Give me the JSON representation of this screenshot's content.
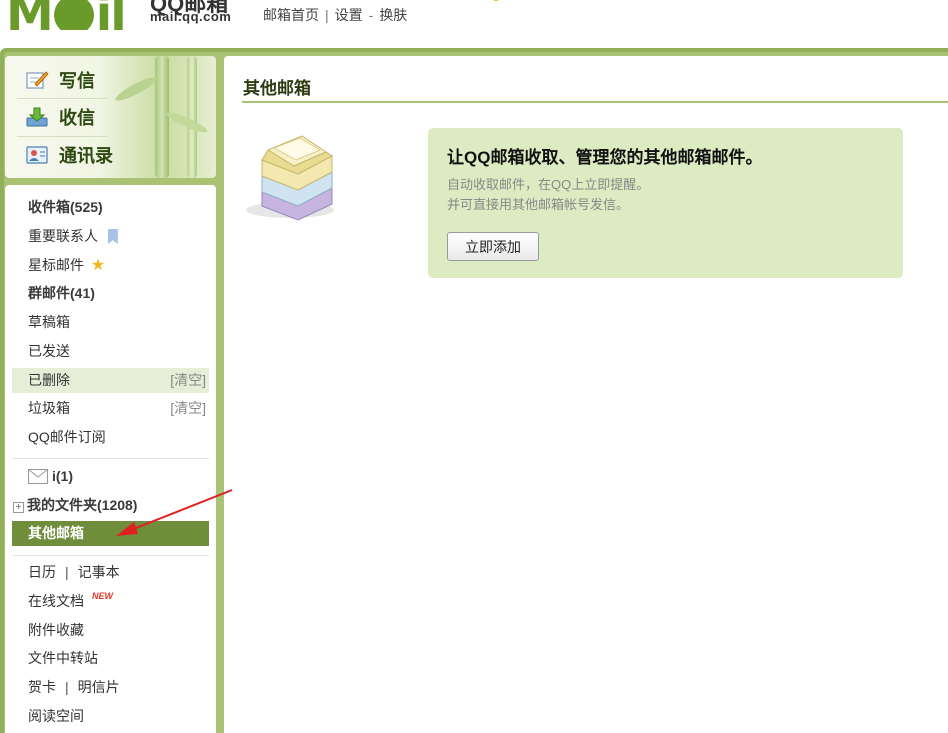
{
  "header": {
    "logo_letters": "M  il",
    "brand_cn": "QQ邮箱",
    "brand_url": "mail.qq.com",
    "links": [
      "邮箱首页",
      "设置",
      "换肤"
    ],
    "separators": [
      "|",
      "-"
    ]
  },
  "compose": {
    "items": [
      {
        "label": "写信",
        "icon": "pencil-paper-icon"
      },
      {
        "label": "收信",
        "icon": "download-tray-icon"
      },
      {
        "label": "通讯录",
        "icon": "contact-card-icon"
      }
    ]
  },
  "folders": {
    "inbox": "收件箱(525)",
    "important_contacts": "重要联系人",
    "starred": "星标邮件",
    "group_mail": "群邮件(41)",
    "drafts": "草稿箱",
    "sent": "已发送",
    "deleted": "已删除",
    "spam": "垃圾箱",
    "clear_label": "[清空]",
    "subscriptions": "QQ邮件订阅",
    "mail_i": "i(1)",
    "my_folders": "我的文件夹(1208)",
    "other_mailboxes": "其他邮箱",
    "calendar": "日历",
    "notepad": "记事本",
    "pipe": "|",
    "online_docs": "在线文档",
    "new_badge": "NEW",
    "attachments": "附件收藏",
    "file_transfer": "文件中转站",
    "greeting_card": "贺卡",
    "postcard": "明信片",
    "reading_space": "阅读空间"
  },
  "main": {
    "title": "其他邮箱",
    "promo_headline": "让QQ邮箱收取、管理您的其他邮箱邮件。",
    "promo_line1": "自动收取邮件，在QQ上立即提醒。",
    "promo_line2": "并可直接用其他邮箱帐号发信。",
    "add_button": "立即添加"
  },
  "colors": {
    "frame_green": "#a9c274",
    "active_folder_bg": "#6f8d3b",
    "promo_bg": "#dcebc1",
    "arrow_red": "#e02020"
  }
}
